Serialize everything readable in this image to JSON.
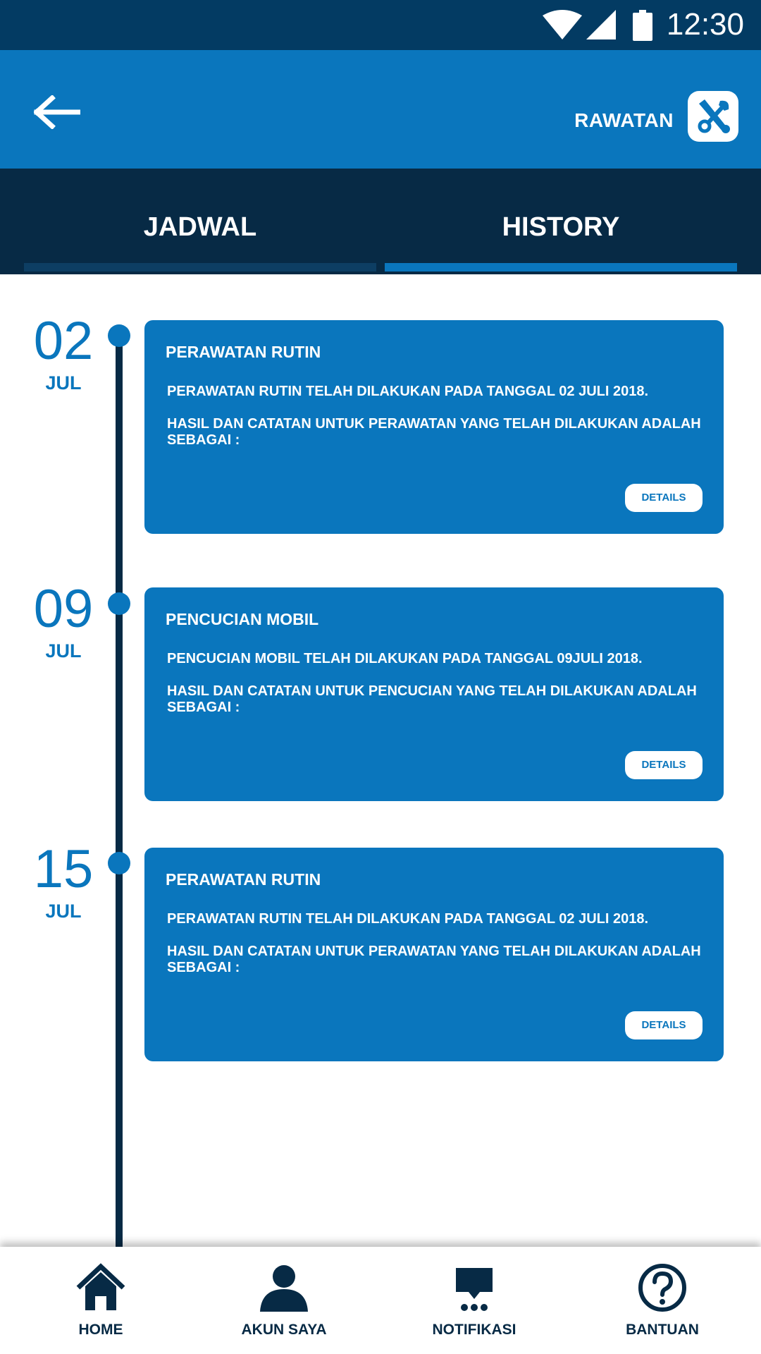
{
  "status_bar": {
    "time": "12:30"
  },
  "app_bar": {
    "title": "RAWATAN",
    "back_icon": "arrow-left-icon",
    "logo_icon": "tools-icon"
  },
  "tabs": [
    {
      "label": "JADWAL",
      "active": false
    },
    {
      "label": "HISTORY",
      "active": true
    }
  ],
  "history": [
    {
      "day": "02",
      "month": "JUL",
      "title": "PERAWATAN RUTIN",
      "line1": "PERAWATAN RUTIN TELAH DILAKUKAN PADA TANGGAL 02 JULI 2018.",
      "line2": "HASIL DAN CATATAN UNTUK PERAWATAN YANG TELAH DILAKUKAN ADALAH SEBAGAI :",
      "details_label": "DETAILS"
    },
    {
      "day": "09",
      "month": "JUL",
      "title": "PENCUCIAN MOBIL",
      "line1": "PENCUCIAN MOBIL TELAH DILAKUKAN PADA TANGGAL 09JULI 2018.",
      "line2": "HASIL DAN CATATAN UNTUK PENCUCIAN YANG TELAH DILAKUKAN ADALAH SEBAGAI :",
      "details_label": "DETAILS"
    },
    {
      "day": "15",
      "month": "JUL",
      "title": "PERAWATAN RUTIN",
      "line1": "PERAWATAN RUTIN TELAH DILAKUKAN PADA TANGGAL 02 JULI 2018.",
      "line2": "HASIL DAN CATATAN UNTUK PERAWATAN YANG TELAH DILAKUKAN ADALAH SEBAGAI :",
      "details_label": "DETAILS"
    }
  ],
  "bottom_nav": [
    {
      "label": "HOME",
      "icon": "home-icon"
    },
    {
      "label": "AKUN SAYA",
      "icon": "user-icon"
    },
    {
      "label": "NOTIFIKASI",
      "icon": "chat-icon"
    },
    {
      "label": "BANTUAN",
      "icon": "help-icon"
    }
  ],
  "colors": {
    "primary": "#0a76bd",
    "dark": "#072a45",
    "status": "#033b63"
  }
}
